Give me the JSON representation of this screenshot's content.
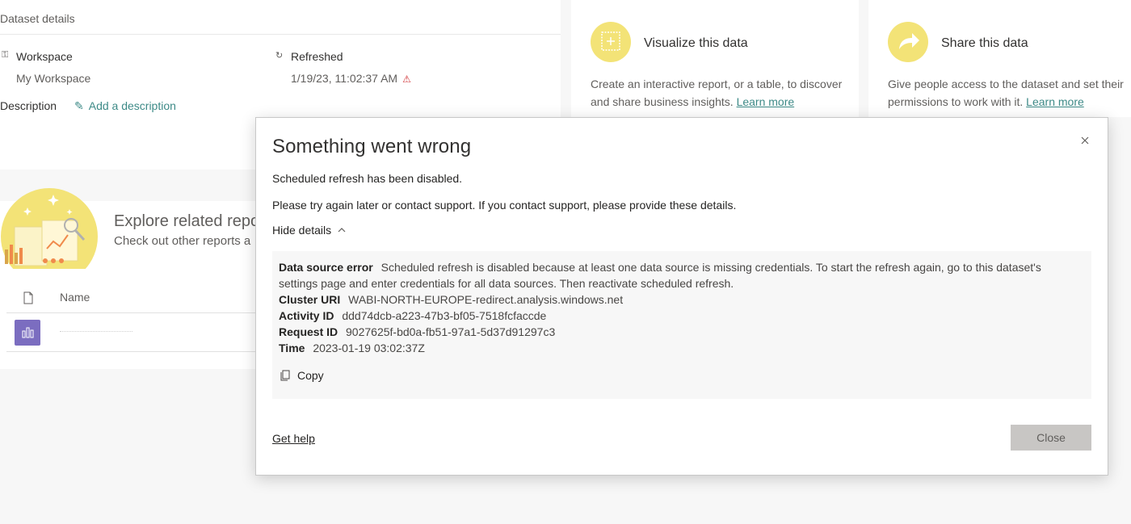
{
  "dataset_details": {
    "header": "Dataset details",
    "workspace_label": "Workspace",
    "workspace_value": "My Workspace",
    "refreshed_label": "Refreshed",
    "refreshed_value": "1/19/23, 11:02:37 AM",
    "description_label": "Description",
    "add_description": "Add a description"
  },
  "visualize_card": {
    "title": "Visualize this data",
    "description": "Create an interactive report, or a table, to discover and share business insights.",
    "link": "Learn more",
    "accent": "#f3e377"
  },
  "share_card": {
    "title": "Share this data",
    "description": "Give people access to the dataset and set their permissions to work with it.",
    "link": "Learn more"
  },
  "explore": {
    "title": "Explore related repo",
    "subtitle": "Check out other reports a",
    "column_name": "Name"
  },
  "dialog": {
    "title": "Something went wrong",
    "message": "Scheduled refresh has been disabled.",
    "support_message": "Please try again later or contact support. If you contact support, please provide these details.",
    "hide_details": "Hide details",
    "details": {
      "data_source_error_label": "Data source error",
      "data_source_error_value": "Scheduled refresh is disabled because at least one data source is missing credentials. To start the refresh again, go to this dataset's settings page and enter credentials for all data sources. Then reactivate scheduled refresh.",
      "cluster_uri_label": "Cluster URI",
      "cluster_uri_value": "WABI-NORTH-EUROPE-redirect.analysis.windows.net",
      "activity_id_label": "Activity ID",
      "activity_id_value": "ddd74dcb-a223-47b3-bf05-7518fcfaccde",
      "request_id_label": "Request ID",
      "request_id_value": "9027625f-bd0a-fb51-97a1-5d37d91297c3",
      "time_label": "Time",
      "time_value": "2023-01-19 03:02:37Z"
    },
    "copy_label": "Copy",
    "get_help": "Get help",
    "close_label": "Close"
  },
  "icons": {
    "workspace": "workspace-icon",
    "refresh": "refresh-icon",
    "warning": "warning-icon",
    "edit": "pencil-icon",
    "close": "close-icon",
    "chevron": "chevron-up-icon",
    "copy": "copy-icon",
    "file": "file-icon",
    "report": "report-icon"
  }
}
